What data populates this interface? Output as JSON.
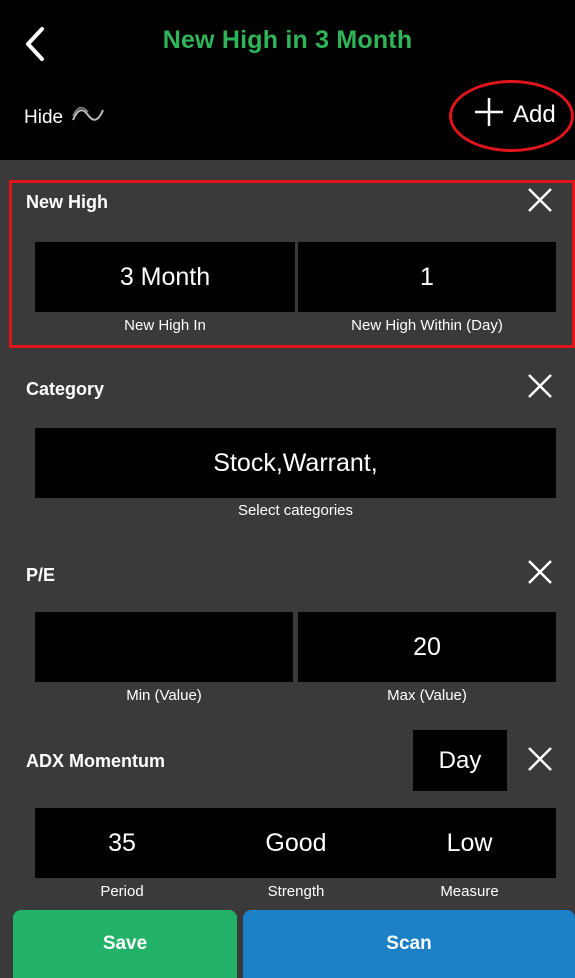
{
  "header": {
    "title": "New High in 3 Month",
    "back_icon": "back-chevron-icon",
    "hide_label": "Hide",
    "hide_icon": "wave-icon",
    "add_label": "Add",
    "add_icon": "plus-icon",
    "title_color": "#2fb457"
  },
  "sections": {
    "new_high": {
      "title": "New High",
      "field1_value": "3 Month",
      "field1_caption": "New High In",
      "field2_value": "1",
      "field2_caption": "New High Within (Day)"
    },
    "category": {
      "title": "Category",
      "value": "Stock,Warrant,",
      "caption": "Select categories"
    },
    "pe": {
      "title": "P/E",
      "min_value": "",
      "min_caption": "Min (Value)",
      "max_value": "20",
      "max_caption": "Max (Value)"
    },
    "adx": {
      "title": "ADX Momentum",
      "timeframe": "Day",
      "period_value": "35",
      "period_caption": "Period",
      "strength_value": "Good",
      "strength_caption": "Strength",
      "measure_value": "Low",
      "measure_caption": "Measure"
    }
  },
  "actions": {
    "save_label": "Save",
    "scan_label": "Scan",
    "save_color": "#21b268",
    "scan_color": "#1c80c6"
  }
}
